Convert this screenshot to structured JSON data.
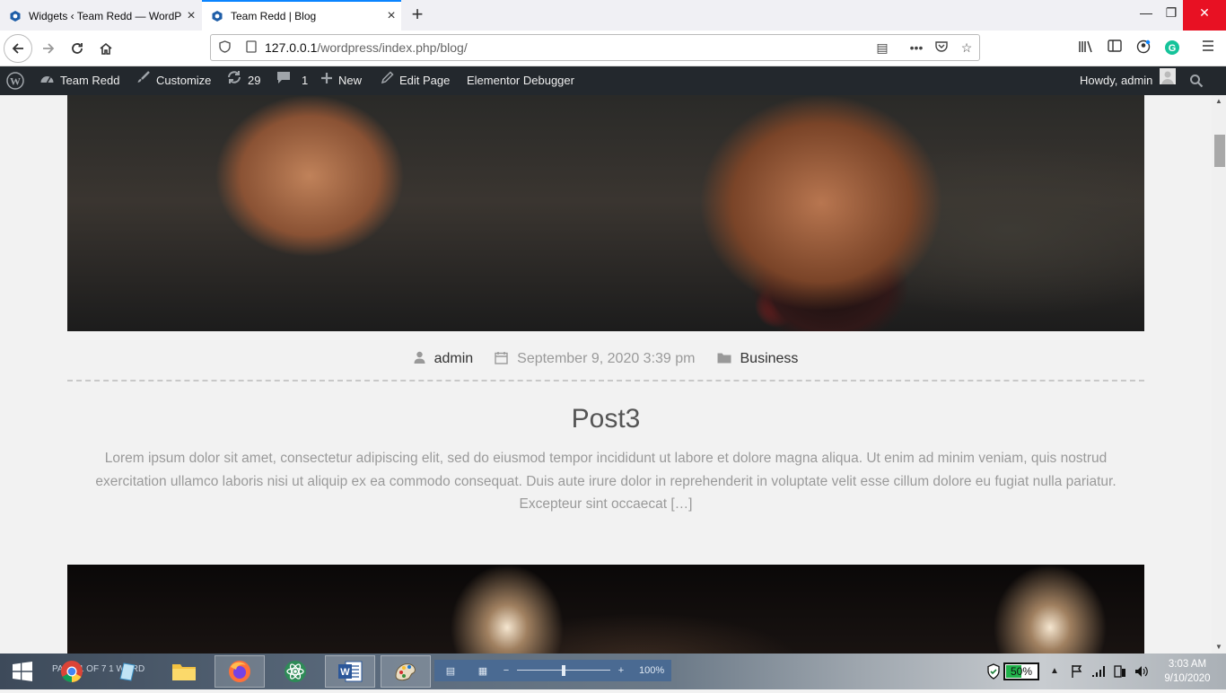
{
  "browser": {
    "tabs": [
      {
        "title": "Widgets ‹ Team Redd — WordPress",
        "active": false
      },
      {
        "title": "Team Redd | Blog",
        "active": true
      }
    ],
    "new_tab_glyph": "+",
    "window_controls": {
      "minimize": "—",
      "restore": "❐",
      "close": "✕"
    },
    "url": {
      "host": "127.0.0.1",
      "path": "/wordpress/index.php/blog/"
    }
  },
  "admin_bar": {
    "site_name": "Team Redd",
    "customize": "Customize",
    "updates_count": "29",
    "comments_count": "1",
    "new": "New",
    "edit_page": "Edit Page",
    "debugger": "Elementor Debugger",
    "howdy": "Howdy, admin"
  },
  "post": {
    "author": "admin",
    "date": "September 9, 2020 3:39 pm",
    "category": "Business",
    "title": "Post3",
    "excerpt_lines": [
      "Lorem ipsum dolor sit amet, consectetur adipiscing elit, sed do eiusmod tempor incididunt ut labore et dolore magna aliqua. Ut enim ad minim veniam, quis nostrud",
      "exercitation ullamco laboris nisi ut aliquip ex ea commodo consequat. Duis aute irure dolor in reprehenderit in voluptate velit esse cillum dolore eu fugiat nulla pariatur.",
      "Excepteur sint occaecat […]"
    ]
  },
  "taskbar": {
    "ghost_text": "PAGE 1 OF 7   1 WORD",
    "zoom": "100%",
    "battery_percent": "50%",
    "battery_level": 0.5,
    "time": "3:03 AM",
    "date": "9/10/2020"
  },
  "colors": {
    "tab_accent": "#0a84ff",
    "admin_bar_bg": "#23282d",
    "battery_fill": "#21b24b",
    "close_button": "#e81123"
  }
}
